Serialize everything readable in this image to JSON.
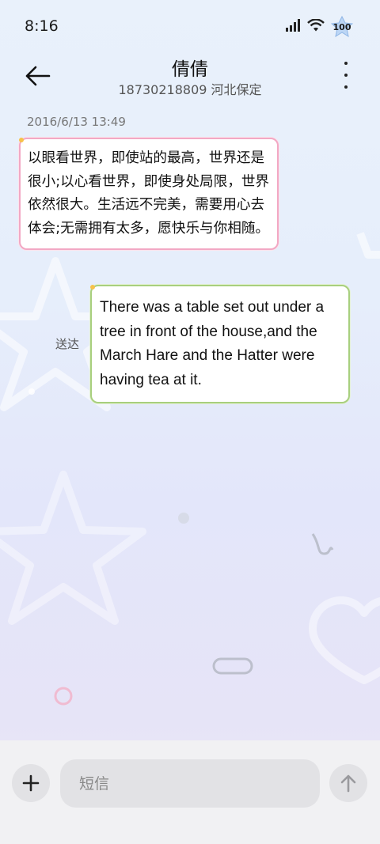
{
  "status_bar": {
    "time": "8:16",
    "battery_level": "100",
    "icons": [
      "signal-icon",
      "wifi-icon",
      "battery-icon"
    ]
  },
  "header": {
    "contact_name": "倩倩",
    "contact_subtitle": "18730218809 河北保定",
    "back_icon": "back-arrow-icon",
    "more_icon": "more-vertical-icon"
  },
  "conversation": {
    "timestamp": "2016/6/13 13:49",
    "messages": [
      {
        "direction": "incoming",
        "text": "以眼看世界，即使站的最高，世界还是很小;以心看世界，即使身处局限，世界依然很大。生活远不完美，需要用心去体会;无需拥有太多，愿快乐与你相随。"
      },
      {
        "direction": "outgoing",
        "status": "送达",
        "text": "There was a table set out under a tree in front of the house,and the March Hare and the Hatter were having tea at it."
      }
    ]
  },
  "composer": {
    "placeholder": "短信",
    "add_icon": "plus-icon",
    "send_icon": "send-arrow-icon"
  },
  "colors": {
    "incoming_border": "#f2a8c4",
    "outgoing_border": "#a8cf7e",
    "background_top": "#e9f1fb",
    "background_bottom": "#ece9f6"
  }
}
